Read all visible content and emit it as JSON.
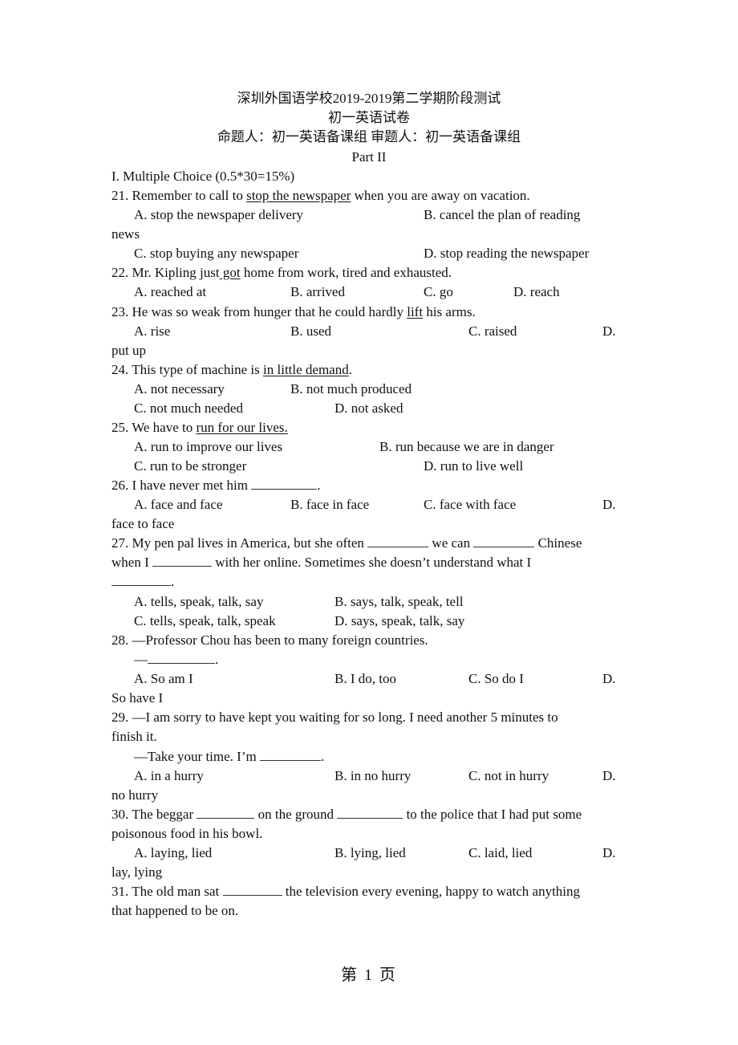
{
  "header": {
    "title": "深圳外国语学校2019-2019第二学期阶段测试",
    "subtitle": "初一英语试卷",
    "authors": "命题人：初一英语备课组 审题人：初一英语备课组",
    "part": "Part II"
  },
  "section": {
    "heading": "I. Multiple Choice (0.5*30=15%)"
  },
  "questions": [
    {
      "number": "21.",
      "stem_before": " Remember to call to ",
      "stem_underlined": "stop the newspaper",
      "stem_after": " when you are away on vacation.",
      "options": [
        "A. stop the newspaper delivery",
        "B. cancel the plan of reading",
        "C. stop buying any newspaper",
        "D. stop reading the newspaper"
      ],
      "wrap": "news"
    },
    {
      "number": "22.",
      "stem_before": " Mr. Kipling just",
      "stem_underlined": " got",
      "stem_after": " home from work, tired and exhausted.",
      "options": [
        "A. reached at",
        "B. arrived",
        "C. go",
        "D. reach"
      ]
    },
    {
      "number": "23.",
      "stem_before": " He was so weak from hunger that he could hardly ",
      "stem_underlined": "lift",
      "stem_after": " his arms.",
      "options": [
        "A. rise",
        "B. used",
        "C. raised",
        "D."
      ],
      "wrap": "put up"
    },
    {
      "number": "24.",
      "stem_before": " This type of machine is ",
      "stem_underlined": "in little demand",
      "stem_after": ".",
      "options": [
        "A. not necessary",
        "B. not much produced",
        "C. not much needed",
        "D. not asked"
      ]
    },
    {
      "number": "25.",
      "stem_before": " We have to ",
      "stem_underlined": "run for our lives.",
      "stem_after": "",
      "options": [
        "A. run to improve our lives",
        "B. run because we are in danger",
        "C. run to be stronger",
        "D. run to live well"
      ]
    },
    {
      "number": "26.",
      "stem": " I have never met him",
      "stem_end": ".",
      "options": [
        "A. face and face",
        "B. face in face",
        "C. face with face",
        "D."
      ],
      "wrap": "face to face"
    },
    {
      "number": "27.",
      "stem_parts": [
        " My pen pal lives in America, but she often",
        "we can",
        "Chinese"
      ],
      "stem_line2": [
        "when I",
        "with her online. Sometimes she doesn’t understand what I"
      ],
      "stem_end": ".",
      "options": [
        "A. tells, speak, talk, say",
        "B. says, talk, speak, tell",
        "C. tells, speak, talk, speak",
        "D. says, speak, talk, say"
      ]
    },
    {
      "number": "28.",
      "stem": " —Professor Chou has been to many foreign countries.",
      "reply_prefix": "—",
      "reply_end": ".",
      "options": [
        "A. So am I",
        "B. I do, too",
        "C. So do I",
        "D."
      ],
      "wrap": "So have I"
    },
    {
      "number": "29.",
      "stem": " —I am sorry to have kept you waiting for so long. I need another 5 minutes to",
      "stem_line2": "finish it.",
      "reply": "—Take your time. I’m",
      "reply_end": ".",
      "options": [
        "A. in a hurry",
        "B. in no hurry",
        "C. not in hurry",
        "D."
      ],
      "wrap": "no hurry"
    },
    {
      "number": "30.",
      "stem_parts": [
        " The beggar",
        "on the ground",
        "to the police that I had put some"
      ],
      "stem_line2": "poisonous food in his bowl.",
      "options": [
        "A. laying, lied",
        "B. lying, lied",
        "C. laid, lied",
        "D."
      ],
      "wrap": "lay, lying"
    },
    {
      "number": "31.",
      "stem_parts": [
        " The old man sat",
        "the television every evening, happy to watch anything"
      ],
      "stem_line2": "that happened to be on."
    }
  ],
  "footer": {
    "page_label": "第  1  页"
  }
}
